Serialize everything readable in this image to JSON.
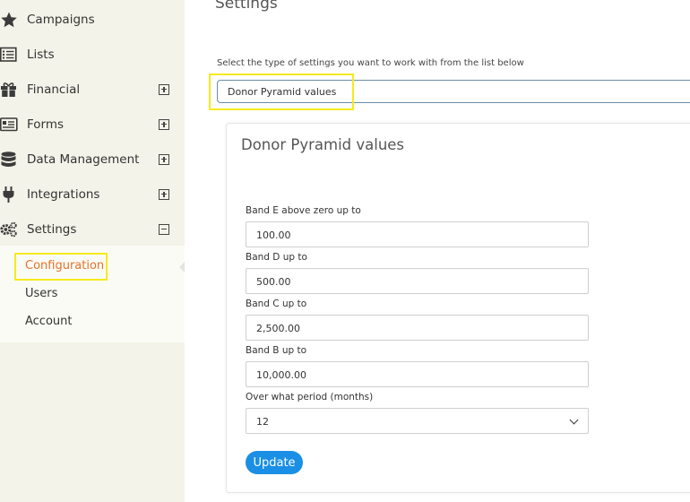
{
  "sidebar": {
    "items": [
      {
        "label": "Campaigns",
        "icon": "star-icon",
        "expander": null
      },
      {
        "label": "Lists",
        "icon": "list-icon",
        "expander": null
      },
      {
        "label": "Financial",
        "icon": "gift-icon",
        "expander": "plus"
      },
      {
        "label": "Forms",
        "icon": "form-icon",
        "expander": "plus"
      },
      {
        "label": "Data Management",
        "icon": "database-icon",
        "expander": "plus"
      },
      {
        "label": "Integrations",
        "icon": "plug-icon",
        "expander": "plus"
      },
      {
        "label": "Settings",
        "icon": "gears-icon",
        "expander": "minus"
      }
    ],
    "submenu": [
      {
        "label": "Configuration",
        "active": true
      },
      {
        "label": "Users",
        "active": false
      },
      {
        "label": "Account",
        "active": false
      }
    ]
  },
  "main": {
    "title": "Settings",
    "select_hint": "Select the type of settings you want to work with from the list below",
    "selected_type": "Donor Pyramid values",
    "card": {
      "title": "Donor Pyramid values",
      "fields": [
        {
          "label": "Band E above zero up to",
          "value": "100.00"
        },
        {
          "label": "Band D up to",
          "value": "500.00"
        },
        {
          "label": "Band C up to",
          "value": "2,500.00"
        },
        {
          "label": "Band B up to",
          "value": "10,000.00"
        }
      ],
      "period": {
        "label": "Over what period (months)",
        "value": "12"
      },
      "update_label": "Update"
    }
  },
  "colors": {
    "sidebar_bg": "#f3f3e9",
    "active_link": "#e8722c",
    "highlight": "#f6ea1d",
    "button": "#1a8fe5"
  }
}
